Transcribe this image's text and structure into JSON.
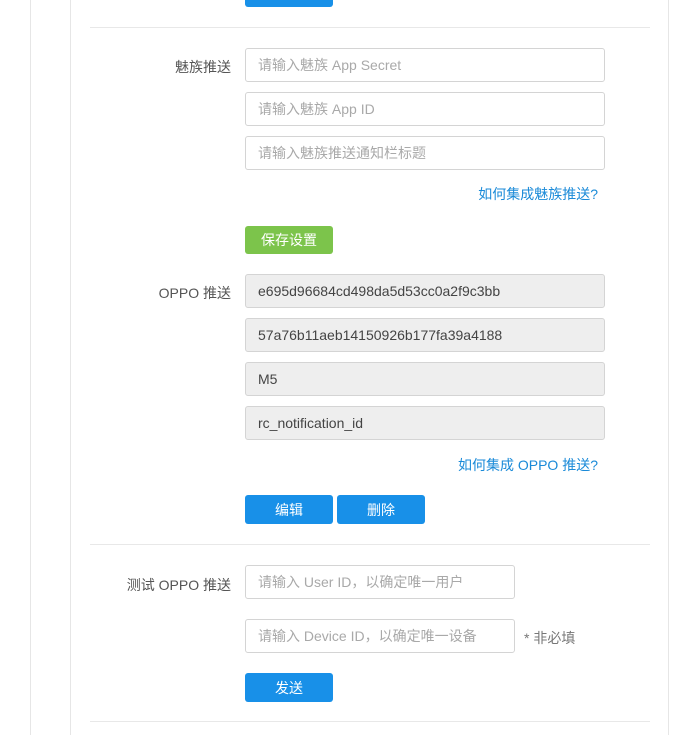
{
  "meizu": {
    "label": "魅族推送",
    "app_secret_placeholder": "请输入魅族 App Secret",
    "app_id_placeholder": "请输入魅族 App ID",
    "title_placeholder": "请输入魅族推送通知栏标题",
    "help_link": "如何集成魅族推送?",
    "save_label": "保存设置"
  },
  "oppo": {
    "label": "OPPO 推送",
    "app_key_value": "e695d96684cd498da5d53cc0a2f9c3bb",
    "app_secret_value": "57a76b11aeb14150926b177fa39a4188",
    "model_value": "M5",
    "channel_id_value": "rc_notification_id",
    "help_link": "如何集成 OPPO 推送?",
    "edit_label": "编辑",
    "delete_label": "删除"
  },
  "test": {
    "label": "测试 OPPO 推送",
    "user_id_placeholder": "请输入 User ID，以确定唯一用户",
    "device_id_placeholder": "请输入 Device ID，以确定唯一设备",
    "optional_note": "* 非必填",
    "send_label": "发送"
  },
  "colors": {
    "primary": "#1890e8",
    "success": "#7cc44b",
    "link": "#1a8ad8"
  }
}
